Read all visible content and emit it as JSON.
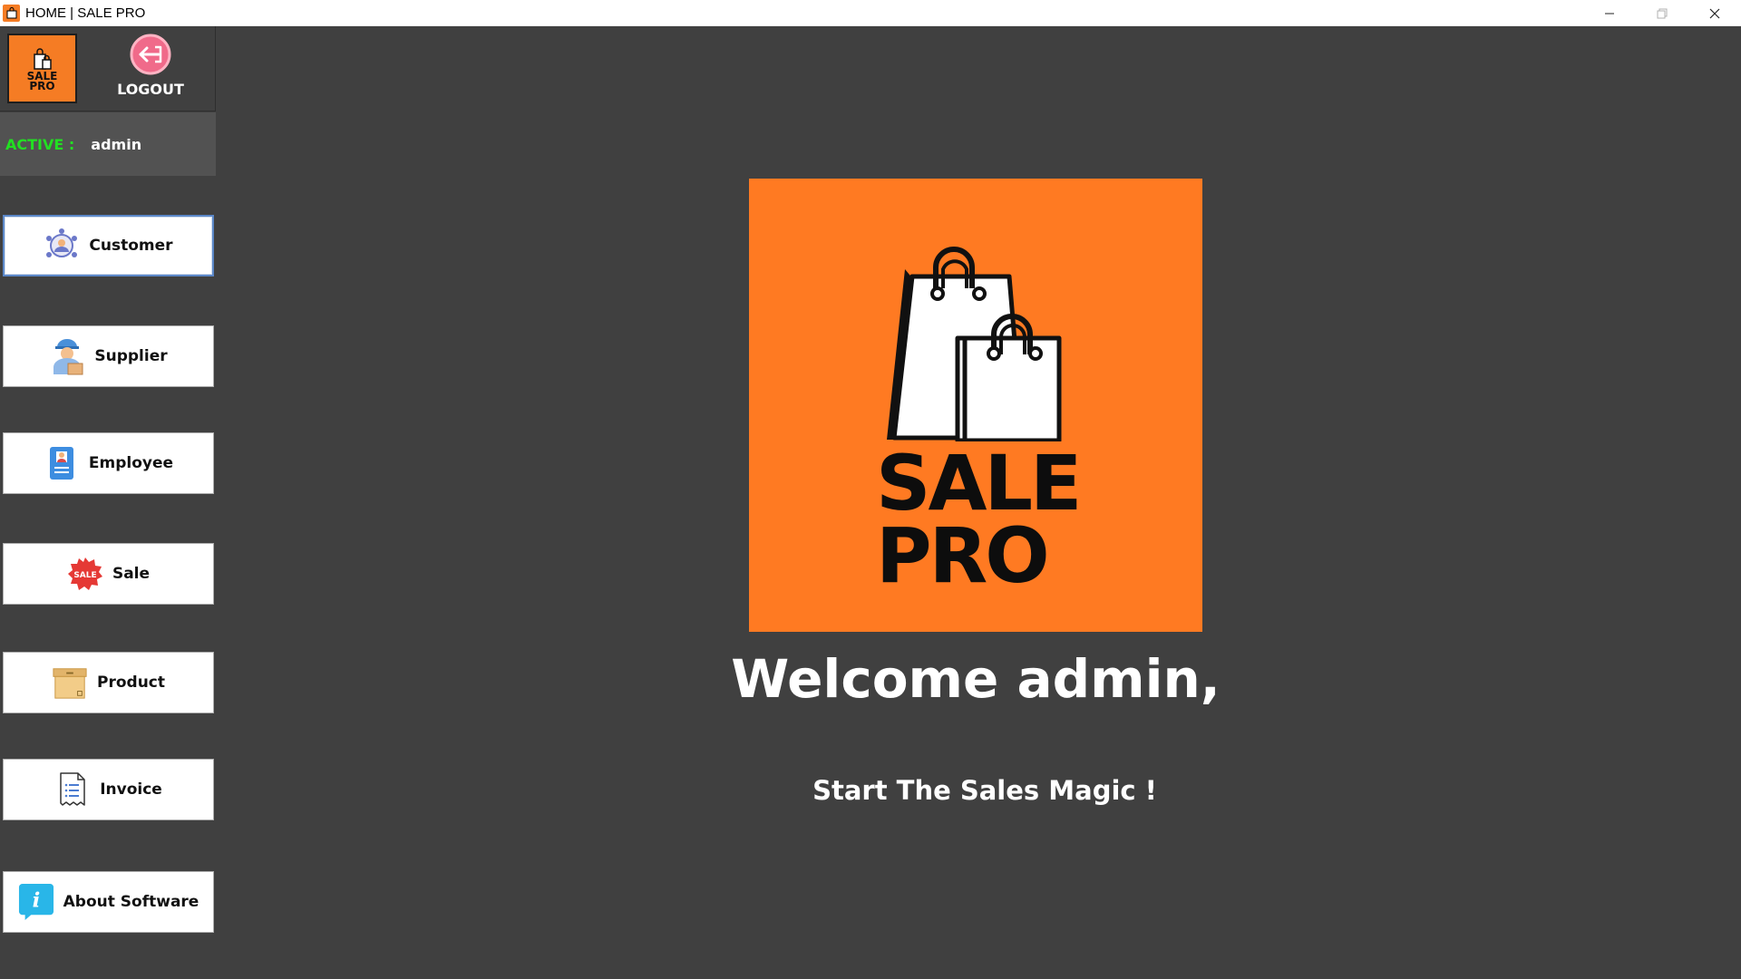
{
  "window": {
    "title": "HOME | SALE PRO",
    "controls": [
      "minimize",
      "restore",
      "close"
    ]
  },
  "sidebar": {
    "mini_logo": {
      "line1": "SALE",
      "line2": "PRO"
    },
    "logout_label": "LOGOUT",
    "active_label": "ACTIVE  :",
    "active_user": "admin",
    "nav": [
      {
        "id": "customer",
        "label": "Customer",
        "icon": "customer-network-icon"
      },
      {
        "id": "supplier",
        "label": "Supplier",
        "icon": "delivery-person-icon"
      },
      {
        "id": "employee",
        "label": "Employee",
        "icon": "id-badge-icon"
      },
      {
        "id": "sale",
        "label": "Sale",
        "icon": "sale-badge-icon"
      },
      {
        "id": "product",
        "label": "Product",
        "icon": "box-icon"
      },
      {
        "id": "invoice",
        "label": "Invoice",
        "icon": "receipt-icon"
      },
      {
        "id": "about",
        "label": "About Software",
        "icon": "info-icon"
      }
    ]
  },
  "main": {
    "logo": {
      "line1": "SALE",
      "line2": "PRO"
    },
    "welcome": "Welcome  admin,",
    "tagline": "Start The Sales Magic !"
  },
  "colors": {
    "background": "#404040",
    "brand_orange": "#ff7a22",
    "active_green": "#22e022",
    "focus_blue": "#5b87c7"
  }
}
